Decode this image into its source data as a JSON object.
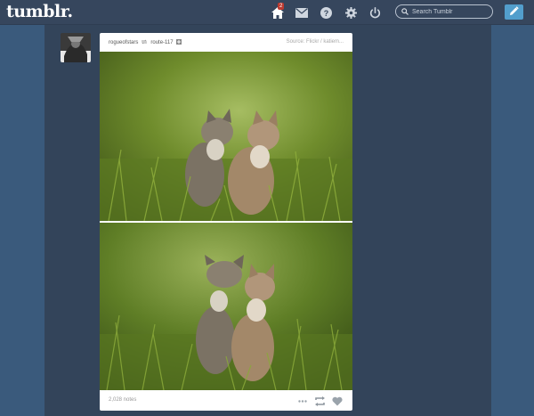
{
  "topbar": {
    "logo_text": "tumblr.",
    "home_badge": "2",
    "search": {
      "placeholder": "Search Tumblr",
      "value": ""
    },
    "icons": [
      "home-icon",
      "mail-icon",
      "help-icon",
      "gear-icon",
      "power-icon",
      "search-icon",
      "pencil-icon"
    ]
  },
  "post": {
    "blog_name": "rogueofstars",
    "reblog_source": "route-117",
    "source_text": "Source: Flickr / katiem...",
    "notes": "2,028 notes",
    "photos": [
      "cats-in-grass-photo-1",
      "cats-in-grass-photo-2"
    ]
  },
  "colors": {
    "background": "#35465c",
    "accent": "#529ecc",
    "badge": "#bc3a30"
  }
}
